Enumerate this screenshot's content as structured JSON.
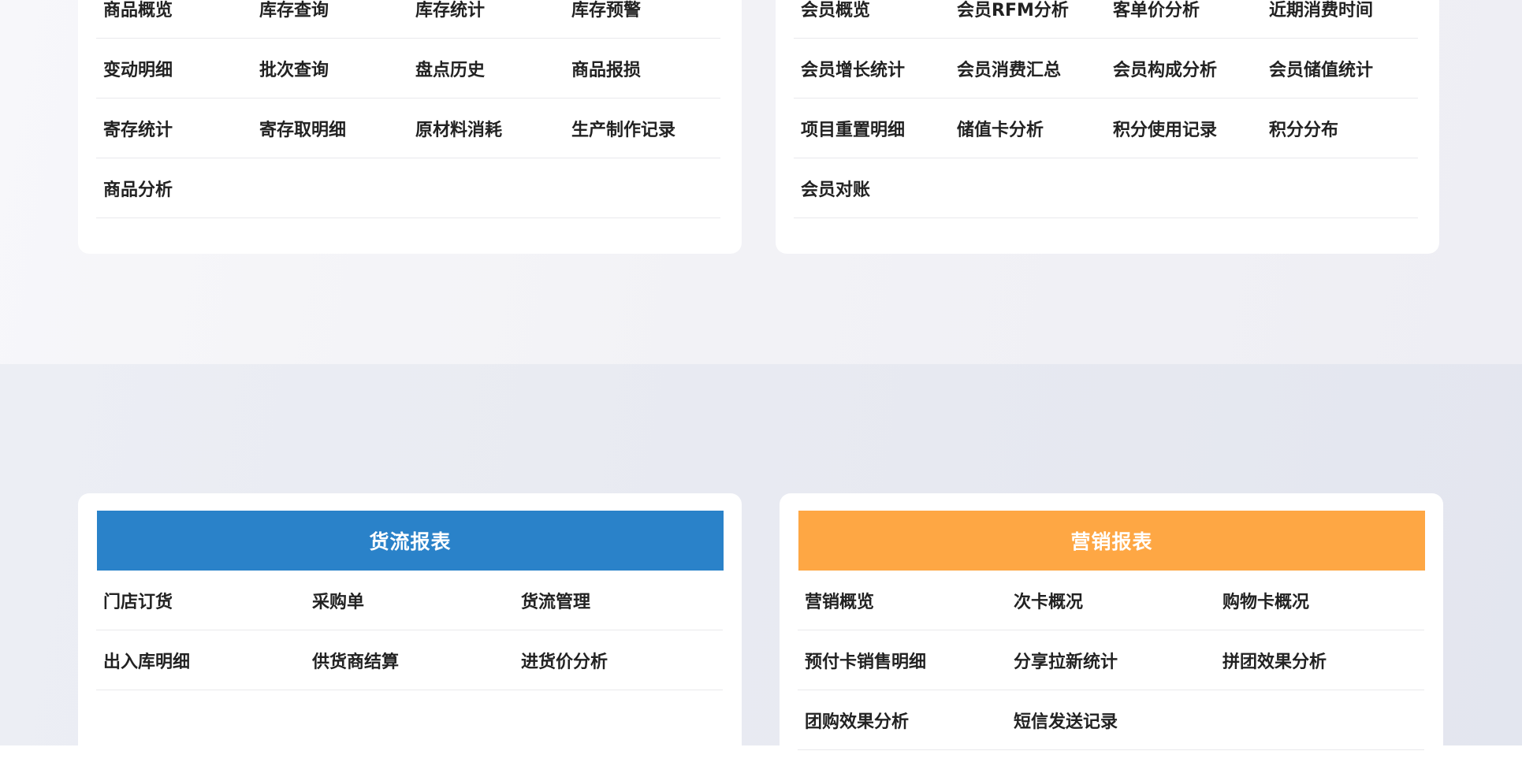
{
  "inventory_card": {
    "items": [
      "商品概览",
      "库存查询",
      "库存统计",
      "库存预警",
      "变动明细",
      "批次查询",
      "盘点历史",
      "商品报损",
      "寄存统计",
      "寄存取明细",
      "原材料消耗",
      "生产制作记录",
      "商品分析"
    ]
  },
  "member_card": {
    "items": [
      "会员概览",
      "会员RFM分析",
      "客单价分析",
      "近期消费时间",
      "会员增长统计",
      "会员消费汇总",
      "会员构成分析",
      "会员储值统计",
      "项目重置明细",
      "储值卡分析",
      "积分使用记录",
      "积分分布",
      "会员对账"
    ]
  },
  "logistics_card": {
    "title": "货流报表",
    "color": "#2a82c9",
    "items": [
      "门店订货",
      "采购单",
      "货流管理",
      "出入库明细",
      "供货商结算",
      "进货价分析"
    ]
  },
  "marketing_card": {
    "title": "营销报表",
    "color": "#fea744",
    "items": [
      "营销概览",
      "次卡概况",
      "购物卡概况",
      "预付卡销售明细",
      "分享拉新统计",
      "拼团效果分析",
      "团购效果分析",
      "短信发送记录"
    ]
  }
}
